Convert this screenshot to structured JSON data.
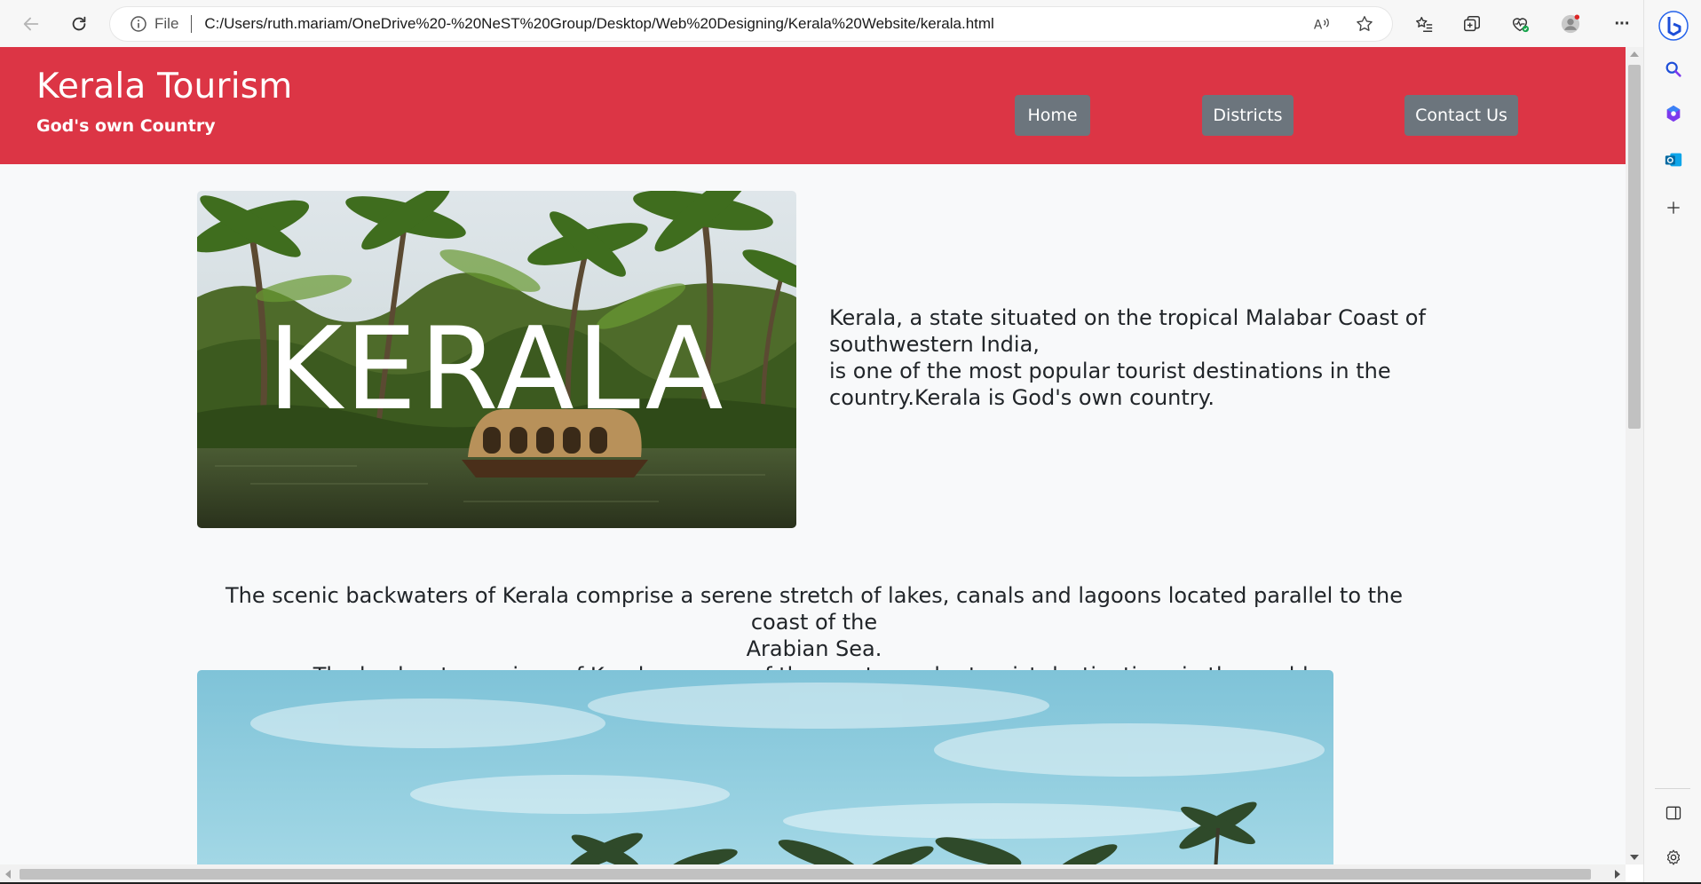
{
  "browser": {
    "file_label": "File",
    "url": "C:/Users/ruth.mariam/OneDrive%20-%20NeST%20Group/Desktop/Web%20Designing/Kerala%20Website/kerala.html",
    "more_label": "···"
  },
  "header": {
    "brand": "Kerala Tourism",
    "tagline": "God's own Country",
    "nav": [
      {
        "label": "Home"
      },
      {
        "label": "Districts"
      },
      {
        "label": "Contact Us"
      }
    ]
  },
  "hero": {
    "image_text": "KERALA",
    "intro_lines": [
      "Kerala, a state situated on the tropical Malabar Coast of",
      "southwestern India,",
      "is one of the most popular tourist destinations in the",
      "country.Kerala is God's own country."
    ]
  },
  "backwaters": {
    "lines": [
      "The scenic backwaters of Kerala comprise a serene stretch of lakes, canals and lagoons located parallel to the coast of the",
      "Arabian Sea.",
      "The backwater regions of Kerala are one of the most popular tourist destinations in the world."
    ]
  },
  "colors": {
    "header_bg": "#dc3545",
    "nav_bg": "#6c757d",
    "page_bg": "#f8f9fa",
    "text": "#212529"
  }
}
